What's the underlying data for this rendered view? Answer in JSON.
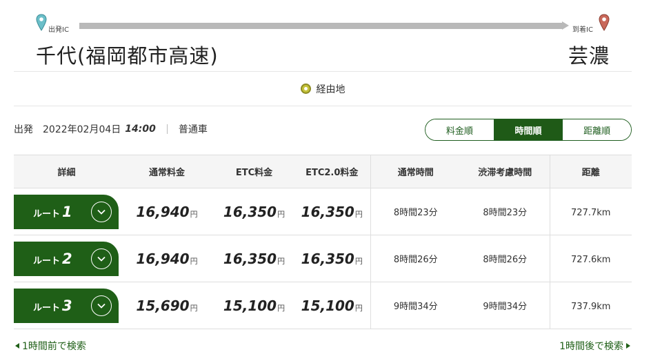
{
  "route": {
    "departure_label": "出発IC",
    "arrival_label": "到着IC",
    "departure_name": "千代(福岡都市高速)",
    "arrival_name": "芸濃",
    "via_label": "経由地"
  },
  "conditions": {
    "label": "出発",
    "date": "2022年02月04日",
    "time": "14:00",
    "vehicle": "普通車"
  },
  "sort_tabs": [
    {
      "label": "料金順",
      "active": false
    },
    {
      "label": "時間順",
      "active": true
    },
    {
      "label": "距離順",
      "active": false
    }
  ],
  "table": {
    "headers": [
      "詳細",
      "通常料金",
      "ETC料金",
      "ETC2.0料金",
      "通常時間",
      "渋滞考慮時間",
      "距離"
    ],
    "yen": "円",
    "route_prefix": "ルート",
    "rows": [
      {
        "num": "1",
        "normal_fee": "16,940",
        "etc_fee": "16,350",
        "etc2_fee": "16,350",
        "normal_time": "8時間23分",
        "congestion_time": "8時間23分",
        "distance": "727.7km"
      },
      {
        "num": "2",
        "normal_fee": "16,940",
        "etc_fee": "16,350",
        "etc2_fee": "16,350",
        "normal_time": "8時間26分",
        "congestion_time": "8時間26分",
        "distance": "727.6km"
      },
      {
        "num": "3",
        "normal_fee": "15,690",
        "etc_fee": "15,100",
        "etc2_fee": "15,100",
        "normal_time": "9時間34分",
        "congestion_time": "9時間34分",
        "distance": "737.9km"
      }
    ]
  },
  "nav": {
    "prev": "1時間前で検索",
    "next": "1時間後で検索"
  },
  "colors": {
    "accent": "#1f5f17",
    "departure_pin": "#6bbfc9",
    "arrival_pin": "#c9685a",
    "via_icon": "#c5c33a"
  }
}
